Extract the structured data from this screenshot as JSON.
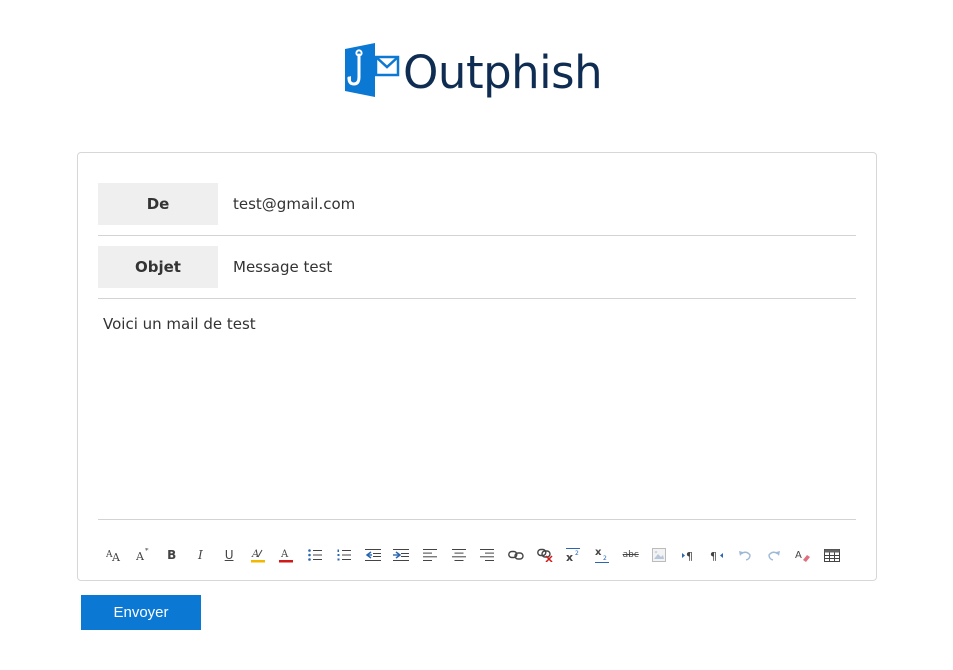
{
  "brand": {
    "name": "Outphish",
    "logo_color": "#0f2d52",
    "mark_color": "#0b78d4"
  },
  "form": {
    "from_label": "De",
    "from_value": "test@gmail.com",
    "subject_label": "Objet",
    "subject_value": "Message test",
    "body_text": "Voici un mail de test"
  },
  "toolbar": {
    "buttons": [
      "font-size-icon",
      "superscript-a-icon",
      "bold-icon",
      "italic-icon",
      "underline-icon",
      "highlight-color-icon",
      "font-color-icon",
      "bullet-list-icon",
      "numbered-list-icon",
      "outdent-icon",
      "indent-icon",
      "align-left-icon",
      "align-center-icon",
      "align-right-icon",
      "insert-link-icon",
      "remove-link-icon",
      "superscript-icon",
      "subscript-icon",
      "strikethrough-icon",
      "insert-image-icon",
      "ltr-icon",
      "rtl-icon",
      "undo-icon",
      "redo-icon",
      "clear-format-icon",
      "insert-table-icon"
    ],
    "labels": {
      "bold": "B",
      "italic": "I",
      "underline": "U",
      "strike": "abc"
    }
  },
  "actions": {
    "send_label": "Envoyer",
    "send_color": "#0b78d4"
  }
}
